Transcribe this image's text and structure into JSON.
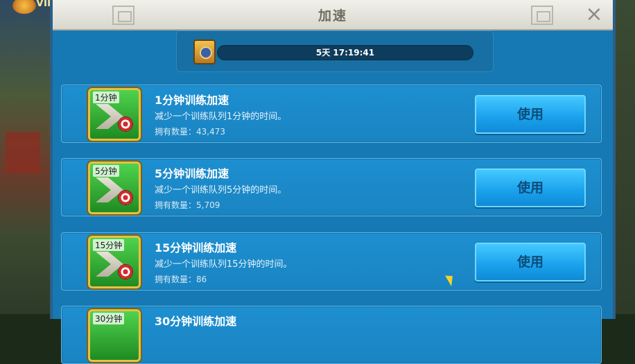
{
  "header": {
    "vip_label": "VIP",
    "title": "加速",
    "close_icon": "×"
  },
  "timer": {
    "remaining": "5天 17:19:41"
  },
  "items": [
    {
      "badge": "1分钟",
      "title": "1分钟训练加速",
      "description": "减少一个训练队列1分钟的时间。",
      "owned": "拥有数量：43,473",
      "use_label": "使用"
    },
    {
      "badge": "5分钟",
      "title": "5分钟训练加速",
      "description": "减少一个训练队列5分钟的时间。",
      "owned": "拥有数量：5,709",
      "use_label": "使用"
    },
    {
      "badge": "15分钟",
      "title": "15分钟训练加速",
      "description": "减少一个训练队列15分钟的时间。",
      "owned": "拥有数量：86",
      "use_label": "使用"
    },
    {
      "badge": "30分钟",
      "title": "30分钟训练加速",
      "description": "",
      "owned": "",
      "use_label": ""
    }
  ],
  "colors": {
    "dialog_blue": "#1679b3",
    "button_blue": "#1aa0ec",
    "title_bar": "#e5e4dc"
  }
}
